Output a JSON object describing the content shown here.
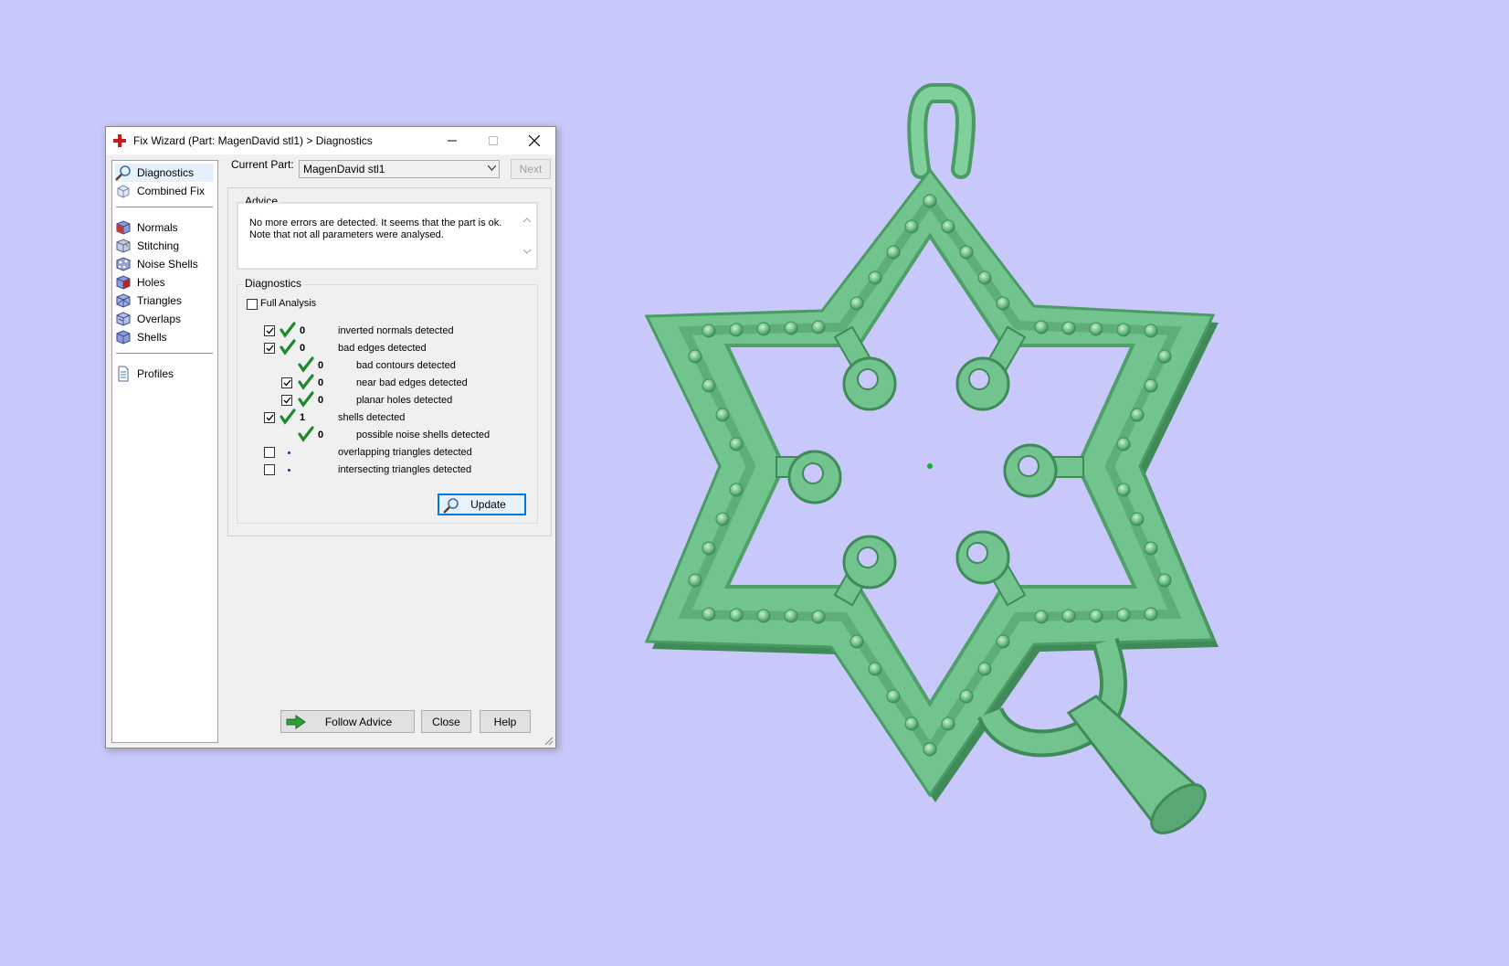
{
  "dialog": {
    "title": "Fix Wizard (Part: MagenDavid stl1) > Diagnostics",
    "nav": {
      "items": [
        {
          "label": "Diagnostics",
          "icon": "magnifier-icon",
          "selected": true
        },
        {
          "label": "Combined Fix",
          "icon": "cube-icon"
        }
      ],
      "items2": [
        {
          "label": "Normals",
          "icon": "normals-cube-icon"
        },
        {
          "label": "Stitching",
          "icon": "stitching-cube-icon"
        },
        {
          "label": "Noise Shells",
          "icon": "noise-shells-icon"
        },
        {
          "label": "Holes",
          "icon": "holes-cube-icon"
        },
        {
          "label": "Triangles",
          "icon": "triangles-cube-icon"
        },
        {
          "label": "Overlaps",
          "icon": "overlaps-cube-icon"
        },
        {
          "label": "Shells",
          "icon": "shells-cube-icon"
        }
      ],
      "items3": [
        {
          "label": "Profiles",
          "icon": "document-icon"
        }
      ]
    },
    "current_part": {
      "label": "Current Part:",
      "value": "MagenDavid stl1"
    },
    "next_label": "Next",
    "advice": {
      "title": "Advice",
      "line1": "No more errors are detected. It seems that the part is ok.",
      "line2": "Note that not all parameters were analysed."
    },
    "diagnostics": {
      "title": "Diagnostics",
      "full_analysis_label": "Full Analysis",
      "rows": [
        {
          "checked": true,
          "status": "ok",
          "count": "0",
          "label": "inverted normals detected",
          "indent": 0
        },
        {
          "checked": true,
          "status": "ok",
          "count": "0",
          "label": "bad edges detected",
          "indent": 0
        },
        {
          "checked": null,
          "status": "ok",
          "count": "0",
          "label": "bad contours detected",
          "indent": 1
        },
        {
          "checked": true,
          "status": "ok",
          "count": "0",
          "label": "near bad edges detected",
          "indent": 1
        },
        {
          "checked": true,
          "status": "ok",
          "count": "0",
          "label": "planar holes detected",
          "indent": 1
        },
        {
          "checked": true,
          "status": "ok",
          "count": "1",
          "label": "shells detected",
          "indent": 0
        },
        {
          "checked": null,
          "status": "ok",
          "count": "0",
          "label": "possible noise shells detected",
          "indent": 1
        },
        {
          "checked": false,
          "status": "not-run",
          "count": "",
          "label": "overlapping triangles detected",
          "indent": 0
        },
        {
          "checked": false,
          "status": "not-run",
          "count": "",
          "label": "intersecting triangles detected",
          "indent": 0
        }
      ],
      "update_label": "Update"
    },
    "footer": {
      "follow_advice_label": "Follow Advice",
      "close_label": "Close",
      "help_label": "Help"
    }
  },
  "colors": {
    "background": "#c8c8fa",
    "model": "#74c58f",
    "check_green": "#1a8a2a",
    "accent": "#0078d7"
  }
}
